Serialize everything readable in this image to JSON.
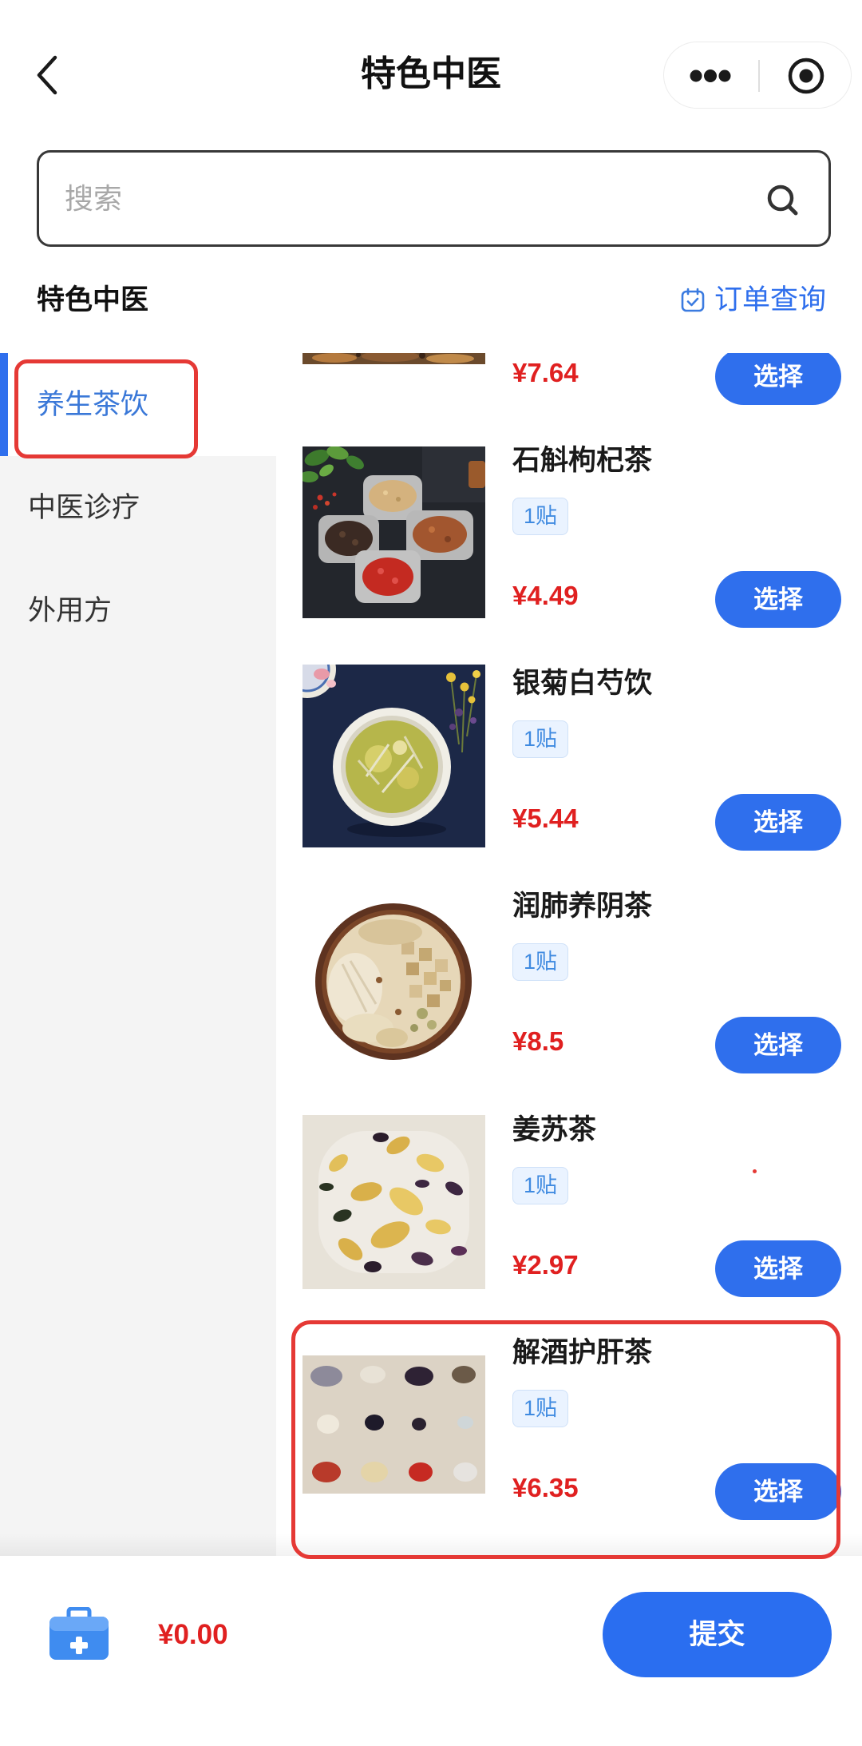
{
  "header": {
    "title": "特色中医",
    "back_icon": "chevron-left-icon",
    "more_icon": "more-dots-icon",
    "mini_program_icon": "target-circle-icon"
  },
  "search": {
    "placeholder": "搜索",
    "value": "",
    "icon": "search-icon"
  },
  "section": {
    "title": "特色中医",
    "order_query": {
      "label": "订单查询",
      "icon": "calendar-check-icon"
    }
  },
  "sidebar": {
    "items": [
      {
        "label": "养生茶饮",
        "active": true
      },
      {
        "label": "中医诊疗",
        "active": false
      },
      {
        "label": "外用方",
        "active": false
      }
    ]
  },
  "products": [
    {
      "price": "¥7.64",
      "button_label": "选择"
    },
    {
      "name": "石斛枸杞茶",
      "badge": "1贴",
      "price": "¥4.49",
      "button_label": "选择"
    },
    {
      "name": "银菊白芍饮",
      "badge": "1贴",
      "price": "¥5.44",
      "button_label": "选择"
    },
    {
      "name": "润肺养阴茶",
      "badge": "1贴",
      "price": "¥8.5",
      "button_label": "选择"
    },
    {
      "name": "姜苏茶",
      "badge": "1贴",
      "price": "¥2.97",
      "button_label": "选择"
    },
    {
      "name": "解酒护肝茶",
      "badge": "1贴",
      "price": "¥6.35",
      "button_label": "选择"
    }
  ],
  "footer": {
    "cart_icon": "medicine-box-icon",
    "total": "¥0.00",
    "submit_label": "提交"
  },
  "colors": {
    "accent": "#2f6fed",
    "price": "#e02020",
    "highlight": "#e53935",
    "sidebar_bg": "#f4f4f4"
  }
}
